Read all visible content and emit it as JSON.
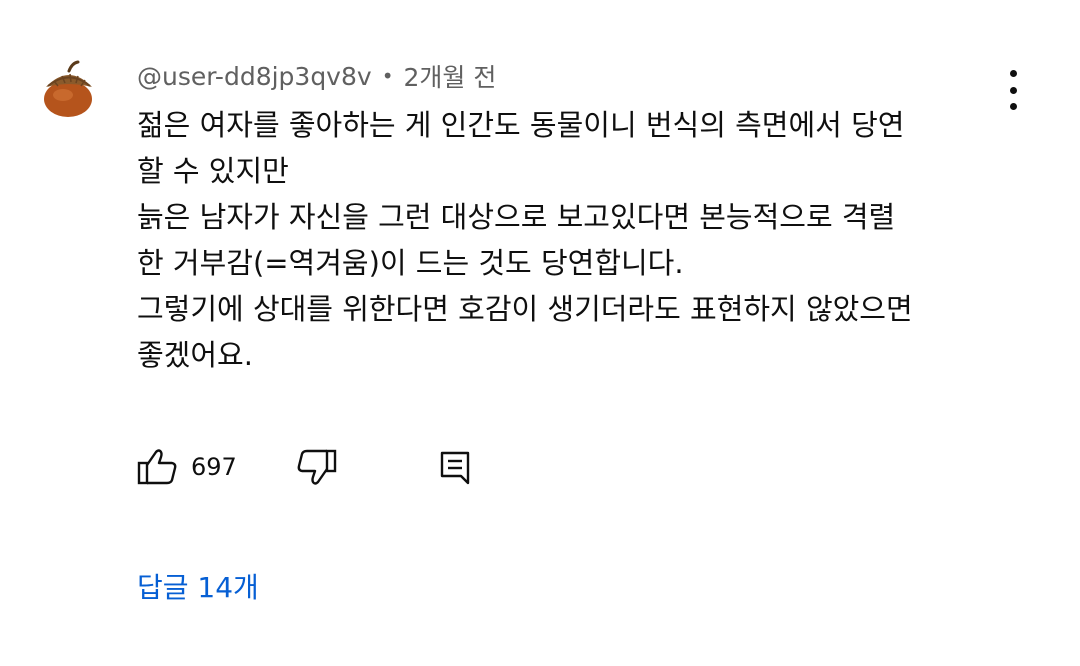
{
  "comment": {
    "author": "@user-dd8jp3qv8v",
    "separator": "•",
    "time": "2개월 전",
    "lines": [
      "젊은 여자를 좋아하는 게 인간도 동물이니 번식의 측면에서 당연",
      "할 수 있지만",
      "늙은 남자가 자신을 그런 대상으로 보고있다면 본능적으로 격렬",
      "한 거부감(=역겨움)이 드는 것도 당연합니다.",
      "그렇기에 상대를 위한다면 호감이 생기더라도 표현하지 않았으면",
      "좋겠어요."
    ]
  },
  "actions": {
    "like_icon": "thumbs-up-icon",
    "like_count": "697",
    "dislike_icon": "thumbs-down-icon",
    "reply_icon": "comment-reply-icon"
  },
  "more_icon": "more-vertical-icon",
  "replies_label": "답글 14개",
  "colors": {
    "text": "#0f0f0f",
    "meta": "#606060",
    "link": "#065fd4",
    "avatar": "#b5541c"
  }
}
